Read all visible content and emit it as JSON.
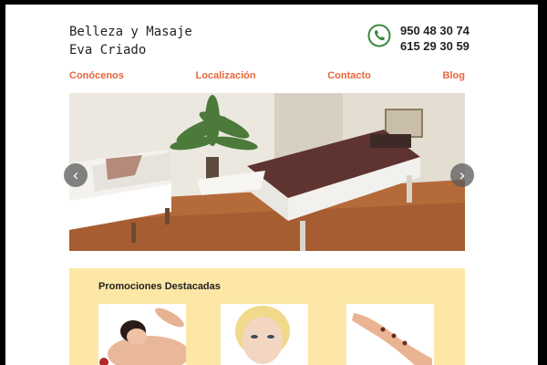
{
  "brand": {
    "line1": "Belleza y Masaje",
    "line2": "Eva Criado"
  },
  "contact": {
    "icon": "phone-icon",
    "phone1": "950 48 30 74",
    "phone2": "615 29 30 59",
    "accent": "#3b8a3e"
  },
  "nav": {
    "items": [
      "Conócenos",
      "Localización",
      "Contacto",
      "Blog"
    ],
    "color": "#e8663a"
  },
  "carousel": {
    "prev_icon": "chevron-left-icon",
    "next_icon": "chevron-right-icon",
    "prev_glyph": "‹",
    "next_glyph": "›"
  },
  "promotions": {
    "title": "Promociones Destacadas",
    "background": "#fde7a6"
  }
}
